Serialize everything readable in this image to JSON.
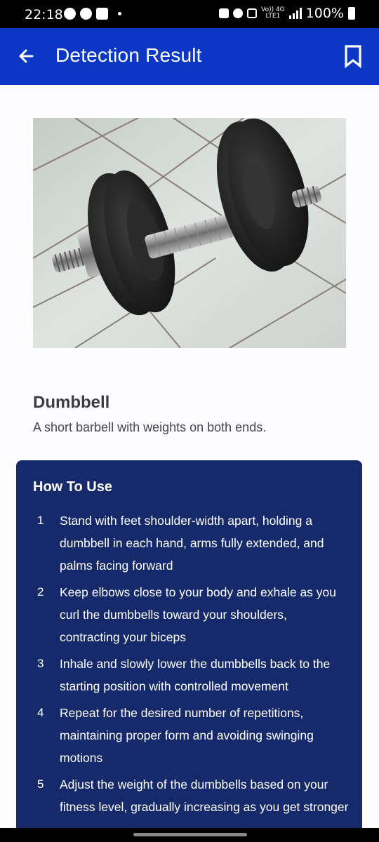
{
  "status_bar": {
    "time": "22:18",
    "network_top": "Vo)) 4G",
    "network_bottom": "LTE1",
    "battery": "100%"
  },
  "app_bar": {
    "title": "Detection Result",
    "back_icon": "arrow-left-icon",
    "bookmark_icon": "bookmark-outline-icon"
  },
  "result": {
    "name": "Dumbbell",
    "description": "A short barbell with weights on both ends."
  },
  "how_to_use": {
    "title": "How To Use",
    "steps": [
      {
        "number": "1",
        "text": "Stand with feet shoulder-width apart, holding a dumbbell in each hand, arms fully extended, and palms facing forward"
      },
      {
        "number": "2",
        "text": "Keep elbows close to your body and exhale as you curl the dumbbells toward your shoulders, contracting your biceps"
      },
      {
        "number": "3",
        "text": "Inhale and slowly lower the dumbbells back to the starting position with controlled movement"
      },
      {
        "number": "4",
        "text": "Repeat for the desired number of repetitions, maintaining proper form and avoiding swinging motions"
      },
      {
        "number": "5",
        "text": "Adjust the weight of the dumbbells based on your fitness level, gradually increasing as you get stronger"
      }
    ]
  },
  "colors": {
    "app_bar": "#0b37c4",
    "card": "#162a6b"
  }
}
